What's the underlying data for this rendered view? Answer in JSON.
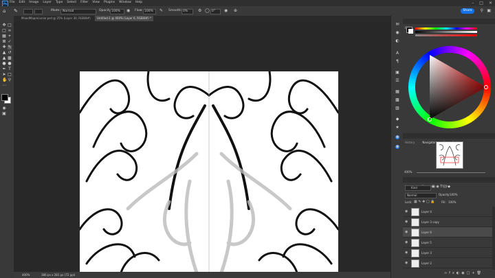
{
  "menu": {
    "app_icon": "Ps",
    "items": [
      "File",
      "Edit",
      "Image",
      "Layer",
      "Type",
      "Select",
      "Filter",
      "View",
      "Plugins",
      "Window",
      "Help"
    ]
  },
  "options": {
    "mode_label": "Mode:",
    "mode_value": "Normal",
    "opacity_label": "Opacity:",
    "opacity_value": "100%",
    "flow_label": "Flow:",
    "flow_value": "100%",
    "smoothing_label": "Smoothing:",
    "smoothing_value": "0%",
    "angle_value": "0°",
    "share_label": "Share"
  },
  "tabs": [
    {
      "label": "MixedMaprecursor.psd @ 25% (Layer 30, RGB/8#)"
    },
    {
      "label": "Untitled-1 @ 400% (Layer 6, RGB/8#) *"
    }
  ],
  "status": {
    "zoom": "400%",
    "doc_info": "386 px x 281 px (72 ppi)"
  },
  "color_panel": {
    "tab": "Color",
    "foreground": "#000000",
    "background": "#ffffff",
    "hue_marker": "#ff0000"
  },
  "navigator": {
    "tabs": [
      "History",
      "Navigator",
      "Brush Settings"
    ],
    "active_tab": "Navigator",
    "zoom": "400%"
  },
  "layers_panel": {
    "tabs": [
      "Layers",
      "Channels",
      "Paths"
    ],
    "filter_label": "Kind",
    "blend_mode": "Normal",
    "opacity_label": "Opacity:",
    "opacity_value": "100%",
    "lock_label": "Lock:",
    "fill_label": "Fill:",
    "fill_value": "100%",
    "layers": [
      {
        "name": "Layer 4",
        "selected": false
      },
      {
        "name": "Layer 3 copy",
        "selected": false
      },
      {
        "name": "Layer 6",
        "selected": true
      },
      {
        "name": "Layer 5",
        "selected": false
      },
      {
        "name": "Layer 3",
        "selected": false
      },
      {
        "name": "Layer 2",
        "selected": false
      }
    ]
  },
  "icons": {
    "move": "move-tool-icon",
    "brush": "brush-tool-icon",
    "eye": "eye-icon"
  }
}
